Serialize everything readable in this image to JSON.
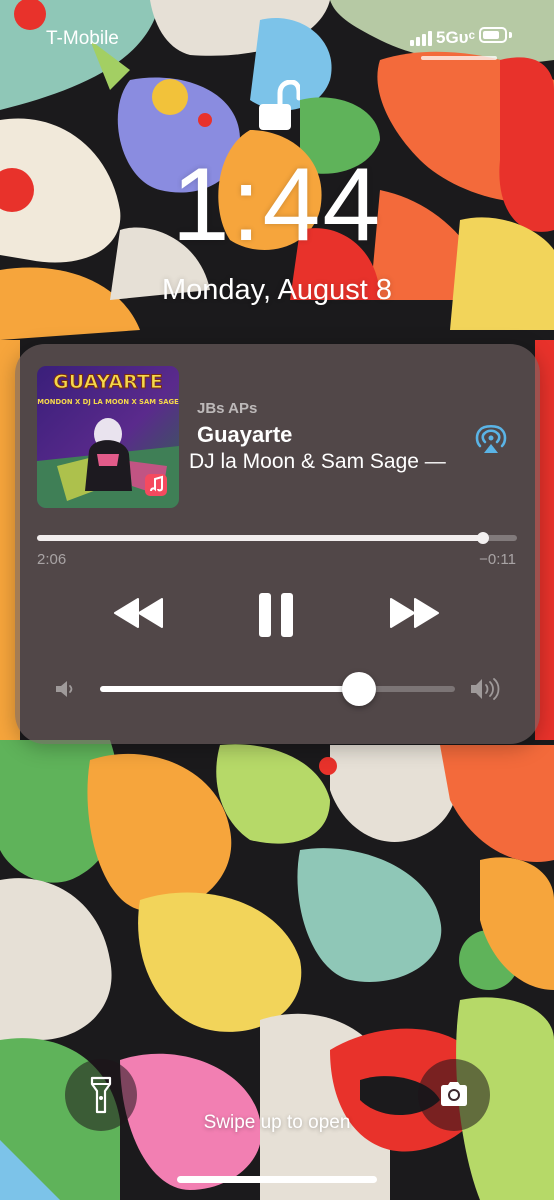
{
  "status_bar": {
    "carrier": "T-Mobile",
    "network": "5Gᴜᶜ",
    "battery_level": 0.8
  },
  "lock_screen": {
    "time": "1:44",
    "date": "Monday, August 8",
    "lock_state": "unlocked"
  },
  "now_playing": {
    "source": "JBs APs",
    "title": "Guayarte",
    "artist": "DJ la Moon & Sam Sage —",
    "elapsed": "2:06",
    "remaining": "−0:11",
    "progress": 0.93,
    "volume": 0.73,
    "artwork": {
      "title_text": "GUAYARTE",
      "credits_text": "MONDON X DJ LA MOON X SAM SAGE"
    },
    "icons": {
      "airplay": "airplay-icon",
      "rewind": "rewind-icon",
      "pause": "pause-icon",
      "forward": "fast-forward-icon",
      "volume_low": "speaker-low-icon",
      "volume_high": "speaker-high-icon",
      "music_app": "apple-music-icon"
    },
    "colors": {
      "accent_airplay": "#5ab4e6",
      "music_badge": "#f54a5f"
    }
  },
  "bottom": {
    "hint": "Swipe up to open",
    "flashlight_icon": "flashlight-icon",
    "camera_icon": "camera-icon"
  }
}
